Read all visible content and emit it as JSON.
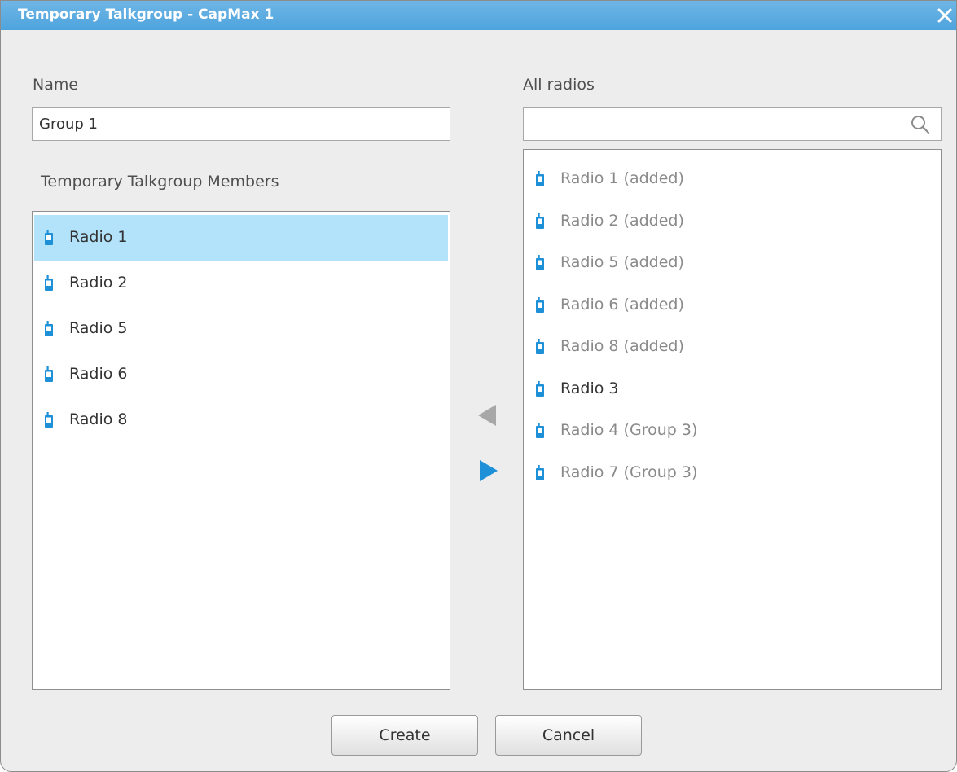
{
  "window": {
    "title": "Temporary Talkgroup - CapMax 1"
  },
  "name_section": {
    "label": "Name",
    "value": "Group 1"
  },
  "members_section": {
    "label": "Temporary Talkgroup Members",
    "items": [
      {
        "label": "Radio 1",
        "selected": true
      },
      {
        "label": "Radio 2",
        "selected": false
      },
      {
        "label": "Radio 5",
        "selected": false
      },
      {
        "label": "Radio 6",
        "selected": false
      },
      {
        "label": "Radio 8",
        "selected": false
      }
    ]
  },
  "all_radios_section": {
    "label": "All radios",
    "search_value": "",
    "items": [
      {
        "label": "Radio 1 (added)",
        "available": false
      },
      {
        "label": "Radio 2 (added)",
        "available": false
      },
      {
        "label": "Radio 5 (added)",
        "available": false
      },
      {
        "label": "Radio 6 (added)",
        "available": false
      },
      {
        "label": "Radio 8 (added)",
        "available": false
      },
      {
        "label": "Radio 3",
        "available": true
      },
      {
        "label": "Radio 4 (Group 3)",
        "available": false
      },
      {
        "label": "Radio 7 (Group 3)",
        "available": false
      }
    ]
  },
  "transfer": {
    "remove_enabled": false,
    "add_enabled": true
  },
  "buttons": {
    "create_label": "Create",
    "cancel_label": "Cancel"
  },
  "icons": {
    "close": "close-icon",
    "search": "search-icon",
    "radio": "handheld-radio-icon",
    "remove_arrow": "arrow-left-icon",
    "add_arrow": "arrow-right-icon"
  },
  "colors": {
    "titlebar": "#4ea3dd",
    "accent": "#1e90d8",
    "selected_row": "#b3e3fb",
    "disabled_arrow": "#a7a7a7",
    "unavailable_text": "#8a8a8a",
    "available_text": "#333333"
  }
}
